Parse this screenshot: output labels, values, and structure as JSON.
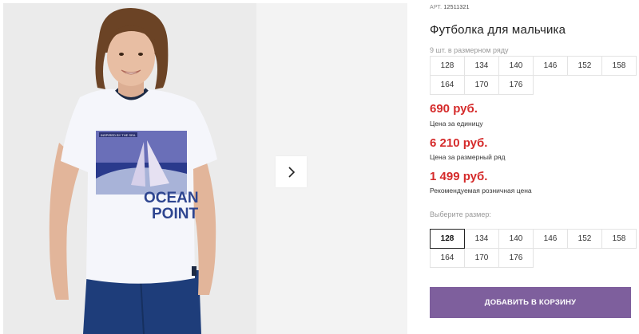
{
  "gallery": {
    "print_caption": "INSPIRED BY THE SEA",
    "print_text_line1": "OCEAN",
    "print_text_line2": "POINT",
    "next_icon": "chevron-right-icon"
  },
  "product": {
    "art_label": "АРТ.",
    "art_number": "12511321",
    "title": "Футболка для мальчика",
    "pack_info": "9 шт. в размерном ряду",
    "pack_sizes": [
      "128",
      "134",
      "140",
      "146",
      "152",
      "158",
      "164",
      "170",
      "176"
    ]
  },
  "prices": {
    "unit_price": "690 руб.",
    "unit_label": "Цена за единицу",
    "pack_price": "6 210 руб.",
    "pack_label": "Цена за размерный ряд",
    "retail_price": "1 499 руб.",
    "retail_label": "Рекомендуемая розничная цена"
  },
  "size_select": {
    "label": "Выберите размер:",
    "sizes": [
      "128",
      "134",
      "140",
      "146",
      "152",
      "158",
      "164",
      "170",
      "176"
    ],
    "selected": "128"
  },
  "cart": {
    "button_label": "ДОБАВИТЬ В КОРЗИНУ"
  },
  "colors": {
    "price": "#d52b2b",
    "button": "#7e5f9d"
  }
}
